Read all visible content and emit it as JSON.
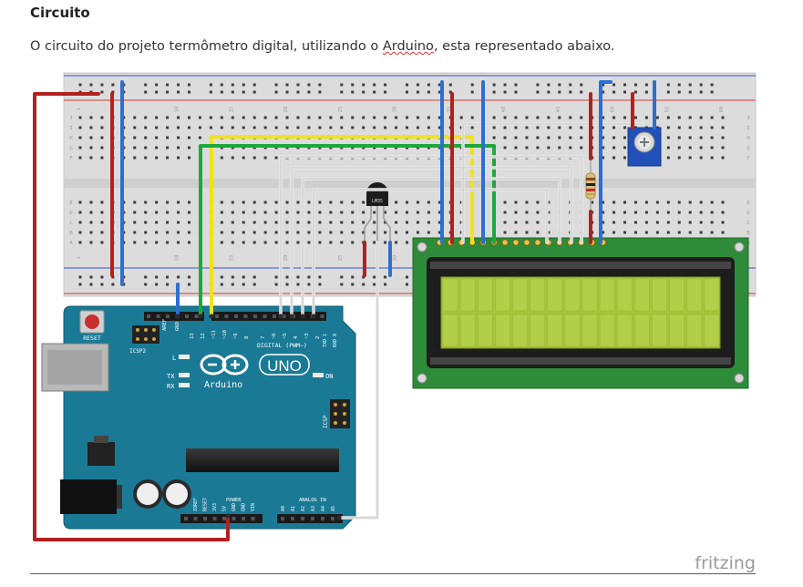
{
  "section": {
    "heading": "Circuito",
    "intro_before": "O circuito do projeto termômetro digital, utilizando o ",
    "intro_link": "Arduino",
    "intro_after": ", esta representado abaixo."
  },
  "breadboard": {
    "column_numbers": [
      "1",
      "5",
      "10",
      "15",
      "20",
      "25",
      "30",
      "35",
      "40",
      "45",
      "50",
      "55",
      "60"
    ],
    "row_letters_top": [
      "J",
      "I",
      "H",
      "G",
      "F"
    ],
    "row_letters_bottom": [
      "E",
      "D",
      "C",
      "B",
      "A"
    ]
  },
  "arduino": {
    "model_label": "UNO",
    "brand_label": "Arduino",
    "reset_label": "RESET",
    "icsp2_label": "ICSP2",
    "icsp_label": "ICSP",
    "led_l": "L",
    "led_tx": "TX",
    "led_rx": "RX",
    "on_label": "ON",
    "aref_label": "AREF",
    "gnd_label": "GND",
    "digital_label": "DIGITAL (PWM~)",
    "txd_label": "TXD 1",
    "rxd_label": "RXD 0",
    "digital_pins": [
      "13",
      "12",
      "~11",
      "~10",
      "~9",
      "8",
      "7",
      "~6",
      "~5",
      "4",
      "~3",
      "2"
    ],
    "power_header": "POWER",
    "analog_header": "ANALOG IN",
    "power_pins": [
      "IOREF",
      "RESET",
      "3V3",
      "5V",
      "GND",
      "GND",
      "VIN"
    ],
    "analog_pins": [
      "A0",
      "A1",
      "A2",
      "A3",
      "A4",
      "A5"
    ]
  },
  "sensor_label": "LM35",
  "watermark": "fritzing",
  "colors": {
    "wire_red": "#b22020",
    "wire_blue": "#2d6fd1",
    "wire_yellow": "#f2e21a",
    "wire_green": "#1fa83a",
    "wire_white": "#e8e8e8",
    "arduino_board": "#1a7a96",
    "lcd_pcb": "#2e8b3a",
    "lcd_screen": "#a7c43a",
    "pot_body": "#2050b8"
  }
}
